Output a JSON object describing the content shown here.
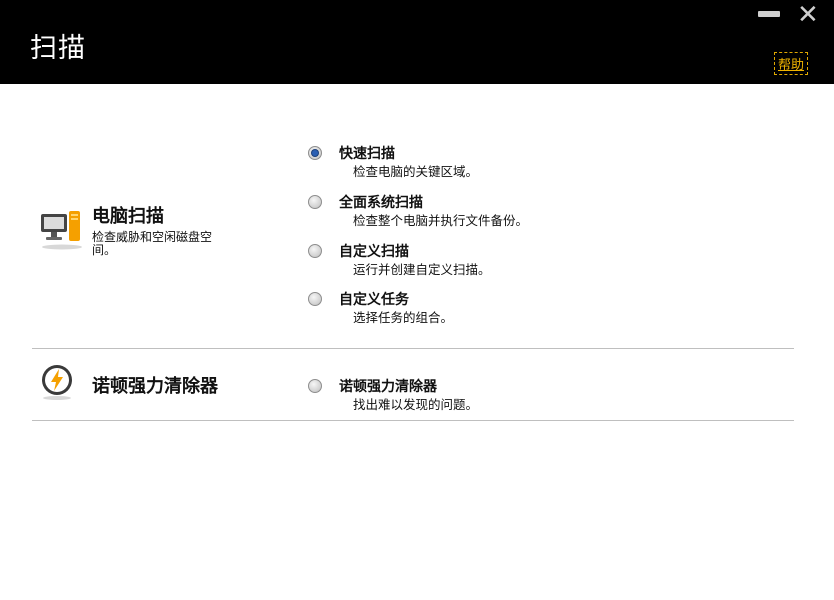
{
  "window": {
    "title": "扫描",
    "help_label": "帮助"
  },
  "sections": {
    "pc_scan": {
      "title": "电脑扫描",
      "desc_line1": "检查威胁和空闲磁盘空",
      "desc_line2": "间。",
      "icon": "computer-icon",
      "options": [
        {
          "label": "快速扫描",
          "desc": "检查电脑的关键区域。",
          "selected": true
        },
        {
          "label": "全面系统扫描",
          "desc": "检查整个电脑并执行文件备份。",
          "selected": false
        },
        {
          "label": "自定义扫描",
          "desc": "运行并创建自定义扫描。",
          "selected": false
        },
        {
          "label": "自定义任务",
          "desc": "选择任务的组合。",
          "selected": false
        }
      ]
    },
    "power_eraser": {
      "title": "诺顿强力清除器",
      "icon": "power-eraser-icon",
      "options": [
        {
          "label": "诺顿强力清除器",
          "desc": "找出难以发现的问题。",
          "selected": false
        }
      ]
    }
  },
  "colors": {
    "titlebar": "#000000",
    "help": "#f0b400",
    "radio_selected": "#2a5fb3",
    "icon_orange": "#f5a000"
  }
}
